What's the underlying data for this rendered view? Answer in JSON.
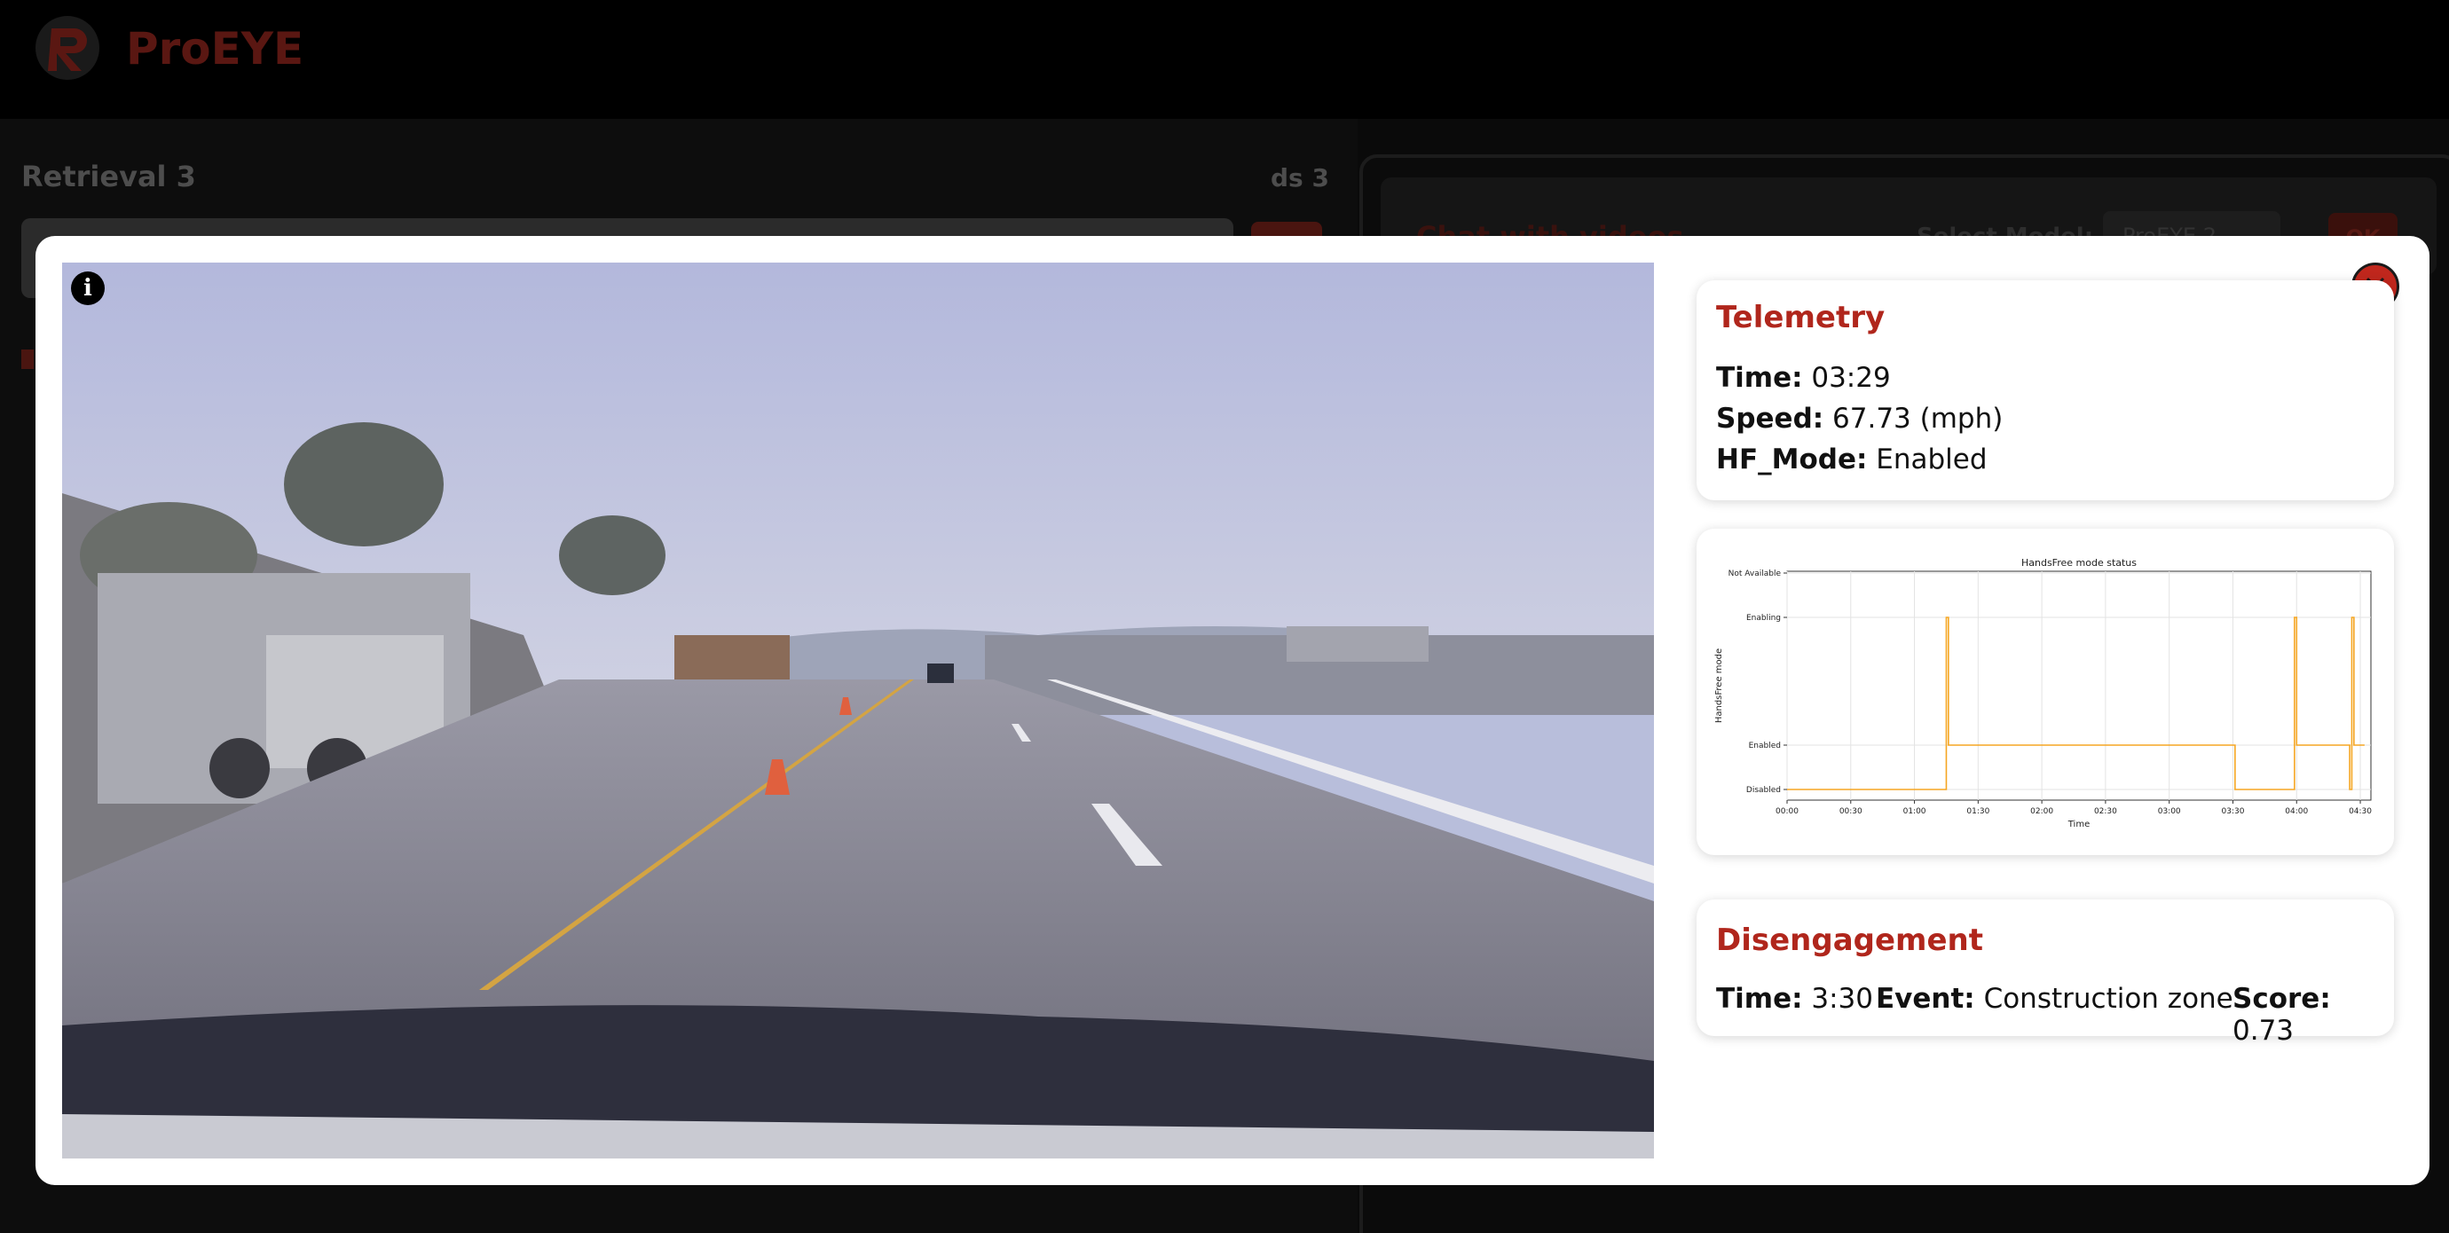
{
  "app": {
    "name": "ProEYE"
  },
  "left_panel": {
    "title": "Retrieval 3",
    "badge": "ds 3"
  },
  "right_panel": {
    "chat_title": "Chat with videos",
    "select_label": "Select Model:",
    "select_value": "ProEYE 2",
    "ok_label": "OK"
  },
  "modal": {
    "info_icon": "info-icon",
    "close_icon": "close-icon",
    "telemetry": {
      "title": "Telemetry",
      "time_label": "Time:",
      "time_value": "03:29",
      "speed_label": "Speed:",
      "speed_value": "67.73 (mph)",
      "hf_label": "HF_Mode:",
      "hf_value": "Enabled"
    },
    "disengagement": {
      "title": "Disengagement",
      "time_label": "Time:",
      "time_value": "3:30",
      "event_label": "Event:",
      "event_value": "Construction zone",
      "score_label": "Score:",
      "score_value": "0.73"
    }
  },
  "colors": {
    "accent": "#b0261c",
    "series": "#f5a623"
  },
  "chart_data": {
    "type": "line",
    "title": "HandsFree mode status",
    "xlabel": "Time",
    "ylabel": "HandsFree mode",
    "y_categories": [
      "Disabled",
      "Enabled",
      "Enabling",
      "Not Available"
    ],
    "x_ticks": [
      "00:00",
      "00:30",
      "01:00",
      "01:30",
      "02:00",
      "02:30",
      "03:00",
      "03:30",
      "04:00",
      "04:30"
    ],
    "xlim": [
      0,
      275
    ],
    "grid": true,
    "series": [
      {
        "x": [
          0,
          75,
          75,
          76,
          76,
          211,
          211,
          239,
          239,
          240,
          240,
          265,
          265,
          266,
          266,
          267,
          267,
          272
        ],
        "y": [
          "Disabled",
          "Disabled",
          "Enabling",
          "Enabling",
          "Enabled",
          "Enabled",
          "Disabled",
          "Disabled",
          "Enabling",
          "Enabling",
          "Enabled",
          "Enabled",
          "Disabled",
          "Disabled",
          "Enabling",
          "Enabling",
          "Enabled",
          "Enabled"
        ]
      }
    ]
  }
}
